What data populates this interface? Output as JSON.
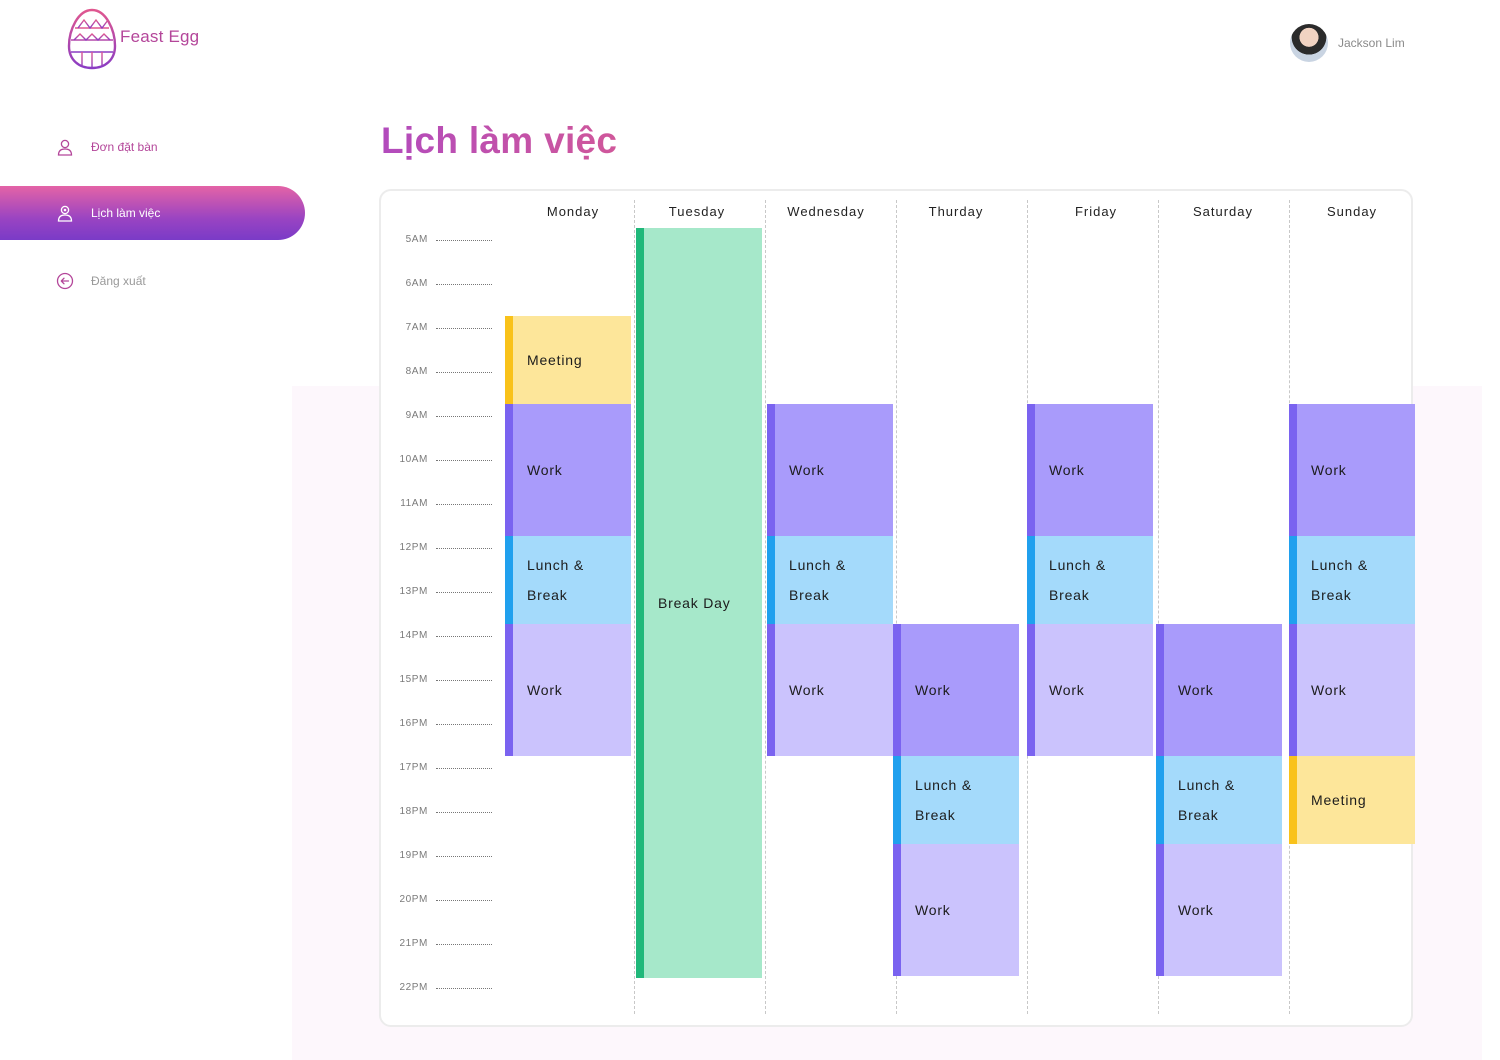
{
  "brand": {
    "name": "Feast Egg",
    "color": "#b4469a"
  },
  "user": {
    "name": "Jackson Lim"
  },
  "sidebar": {
    "items": [
      {
        "label": "Đơn đặt bàn",
        "icon": "user-icon"
      },
      {
        "label": "Lịch làm việc",
        "icon": "calendar-user-icon",
        "active": true
      },
      {
        "label": "Đăng xuất",
        "icon": "logout-icon"
      }
    ]
  },
  "page": {
    "title": "Lịch làm việc"
  },
  "schedule": {
    "days": [
      "Monday",
      "Tuesday",
      "Wednesday",
      "Thurday",
      "Friday",
      "Saturday",
      "Sunday"
    ],
    "times": [
      "5AM",
      "6AM",
      "7AM",
      "8AM",
      "9AM",
      "10AM",
      "11AM",
      "12PM",
      "13PM",
      "14PM",
      "15PM",
      "16PM",
      "17PM",
      "18PM",
      "19PM",
      "20PM",
      "21PM",
      "22PM"
    ],
    "events": [
      {
        "day": "Monday",
        "label": "Meeting",
        "type": "meeting",
        "start": 7,
        "end": 9
      },
      {
        "day": "Monday",
        "label": "Work",
        "type": "work",
        "start": 9,
        "end": 12
      },
      {
        "day": "Monday",
        "label": "Lunch &\nBreak",
        "type": "lunch",
        "start": 12,
        "end": 14
      },
      {
        "day": "Monday",
        "label": "Work",
        "type": "work2",
        "start": 14,
        "end": 17
      },
      {
        "day": "Tuesday",
        "label": "Break Day",
        "type": "break",
        "start": 5,
        "end": 22.05
      },
      {
        "day": "Wednesday",
        "label": "Work",
        "type": "work",
        "start": 9,
        "end": 12
      },
      {
        "day": "Wednesday",
        "label": "Lunch &\nBreak",
        "type": "lunch",
        "start": 12,
        "end": 14
      },
      {
        "day": "Wednesday",
        "label": "Work",
        "type": "work2",
        "start": 14,
        "end": 17
      },
      {
        "day": "Thurday",
        "label": "Work",
        "type": "work",
        "start": 14,
        "end": 17
      },
      {
        "day": "Thurday",
        "label": "Lunch &\nBreak",
        "type": "lunch",
        "start": 17,
        "end": 19
      },
      {
        "day": "Thurday",
        "label": "Work",
        "type": "work2",
        "start": 19,
        "end": 22
      },
      {
        "day": "Friday",
        "label": "Work",
        "type": "work",
        "start": 9,
        "end": 12
      },
      {
        "day": "Friday",
        "label": "Lunch &\nBreak",
        "type": "lunch",
        "start": 12,
        "end": 14
      },
      {
        "day": "Friday",
        "label": "Work",
        "type": "work2",
        "start": 14,
        "end": 17
      },
      {
        "day": "Saturday",
        "label": "Work",
        "type": "work",
        "start": 14,
        "end": 17
      },
      {
        "day": "Saturday",
        "label": "Lunch &\nBreak",
        "type": "lunch",
        "start": 17,
        "end": 19
      },
      {
        "day": "Saturday",
        "label": "Work",
        "type": "work2",
        "start": 19,
        "end": 22
      },
      {
        "day": "Sunday",
        "label": "Work",
        "type": "work",
        "start": 9,
        "end": 12
      },
      {
        "day": "Sunday",
        "label": "Lunch &\nBreak",
        "type": "lunch",
        "start": 12,
        "end": 14
      },
      {
        "day": "Sunday",
        "label": "Work",
        "type": "work2",
        "start": 14,
        "end": 17
      },
      {
        "day": "Sunday",
        "label": "Meeting",
        "type": "meeting",
        "start": 17,
        "end": 19
      }
    ]
  },
  "colors": {
    "meeting": "#fde69a",
    "work": "#a99bfb",
    "work_light": "#cbc3fd",
    "lunch": "#a4dafb",
    "break": "#a6e8ca"
  }
}
